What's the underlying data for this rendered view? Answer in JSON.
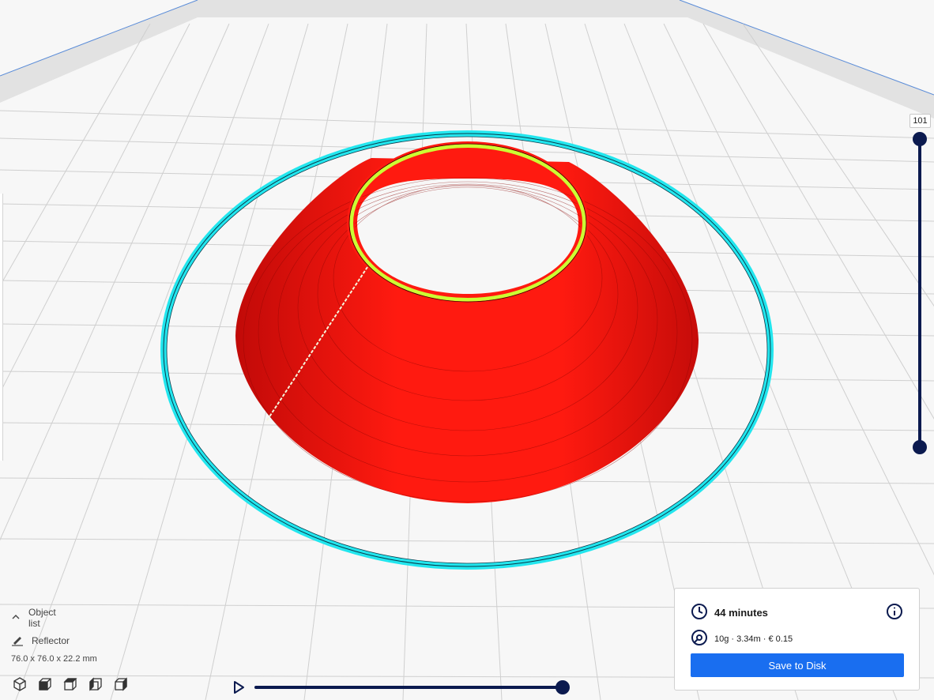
{
  "layer_slider": {
    "current_layer": "101"
  },
  "object_panel": {
    "list_label": "Object list",
    "object_name": "Reflector",
    "dimensions": "76.0 x 76.0 x 22.2 mm"
  },
  "view_buttons": [
    "3d-view-icon",
    "front-view-icon",
    "top-view-icon",
    "left-view-icon",
    "right-view-icon"
  ],
  "print_info": {
    "time": "44 minutes",
    "material": "10g · 3.34m · € 0.15",
    "save_label": "Save to Disk"
  },
  "colors": {
    "model_wall": "#ff1a10",
    "skirt": "#22e6ee",
    "top_layer": "#ccff33",
    "accent": "#196ef0",
    "slider": "#0b1a4f"
  }
}
